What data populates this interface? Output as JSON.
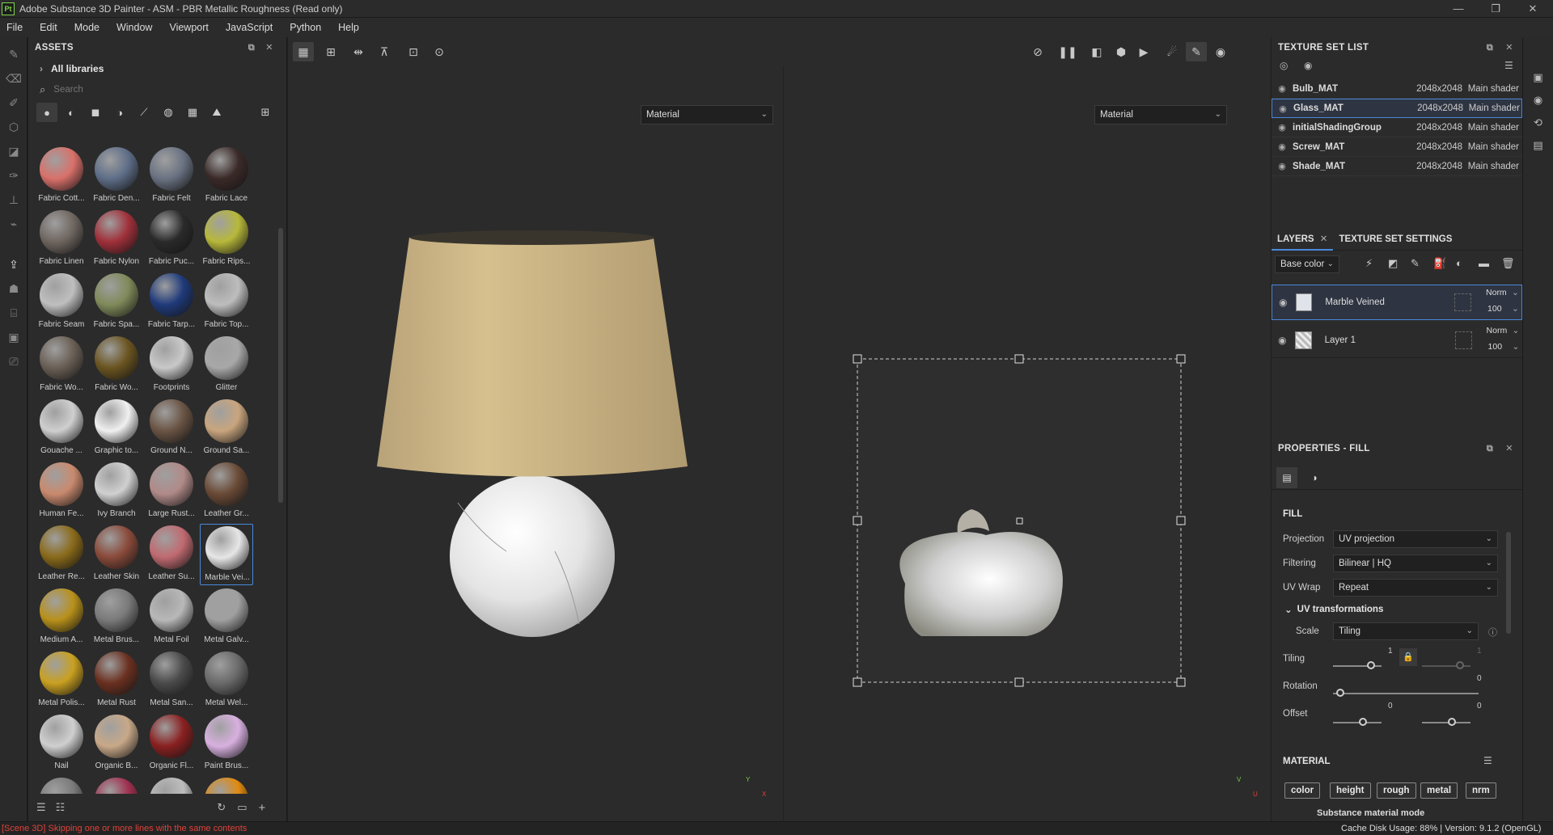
{
  "window": {
    "title": "Adobe Substance 3D Painter - ASM - PBR Metallic Roughness (Read only)",
    "app_badge": "Pt",
    "minimize": "—",
    "maximize": "❐",
    "close": "✕"
  },
  "menu": [
    "File",
    "Edit",
    "Mode",
    "Window",
    "Viewport",
    "JavaScript",
    "Python",
    "Help"
  ],
  "assets": {
    "title": "ASSETS",
    "library": "All libraries",
    "search_placeholder": "Search",
    "items": [
      {
        "label": "Fabric Cott...",
        "color": "#d9706a"
      },
      {
        "label": "Fabric Den...",
        "color": "#5e6e88"
      },
      {
        "label": "Fabric Felt",
        "color": "#6a7282"
      },
      {
        "label": "Fabric Lace",
        "color": "#3a2a28"
      },
      {
        "label": "Fabric Linen",
        "color": "#6f6660"
      },
      {
        "label": "Fabric Nylon",
        "color": "#a0303a"
      },
      {
        "label": "Fabric Puc...",
        "color": "#2a2a2a"
      },
      {
        "label": "Fabric Rips...",
        "color": "#b7b83a"
      },
      {
        "label": "Fabric Seam",
        "color": "#bfbfbf"
      },
      {
        "label": "Fabric Spa...",
        "color": "#7f8a5a"
      },
      {
        "label": "Fabric Tarp...",
        "color": "#1f3a7a"
      },
      {
        "label": "Fabric Top...",
        "color": "#bdbdbd"
      },
      {
        "label": "Fabric Wo...",
        "color": "#6a5f55"
      },
      {
        "label": "Fabric Wo...",
        "color": "#6a5420"
      },
      {
        "label": "Footprints",
        "color": "#c8c8c8"
      },
      {
        "label": "Glitter",
        "color": "#a8a8a8"
      },
      {
        "label": "Gouache ...",
        "color": "#cfcfcf"
      },
      {
        "label": "Graphic to...",
        "color": "#f0f0f0"
      },
      {
        "label": "Ground N...",
        "color": "#6a5444"
      },
      {
        "label": "Ground Sa...",
        "color": "#c9a57e"
      },
      {
        "label": "Human Fe...",
        "color": "#c98a6e"
      },
      {
        "label": "Ivy Branch",
        "color": "#d0d0d0"
      },
      {
        "label": "Large Rust...",
        "color": "#b08a88"
      },
      {
        "label": "Leather Gr...",
        "color": "#6a4a36"
      },
      {
        "label": "Leather Re...",
        "color": "#8a6a1a"
      },
      {
        "label": "Leather Skin",
        "color": "#8a4a3a"
      },
      {
        "label": "Leather Su...",
        "color": "#c06a70"
      },
      {
        "label": "Marble Vei...",
        "color": "#e6e6e6"
      },
      {
        "label": "Medium A...",
        "color": "#b8901a"
      },
      {
        "label": "Metal Brus...",
        "color": "#7a7a7a"
      },
      {
        "label": "Metal Foil",
        "color": "#b8b8b8"
      },
      {
        "label": "Metal Galv...",
        "color": "#a0a0a0"
      },
      {
        "label": "Metal Polis...",
        "color": "#c9a020"
      },
      {
        "label": "Metal Rust",
        "color": "#6a3020"
      },
      {
        "label": "Metal San...",
        "color": "#4a4a4a"
      },
      {
        "label": "Metal Wel...",
        "color": "#6a6a6a"
      },
      {
        "label": "Nail",
        "color": "#cfcfcf"
      },
      {
        "label": "Organic B...",
        "color": "#c8a888"
      },
      {
        "label": "Organic Fl...",
        "color": "#8a2020"
      },
      {
        "label": "Paint Brus...",
        "color": "#d8b0e0"
      },
      {
        "label": "",
        "color": "#7a7a7a"
      },
      {
        "label": "",
        "color": "#a03050"
      },
      {
        "label": "",
        "color": "#bdbdbd"
      },
      {
        "label": "",
        "color": "#e08a10"
      }
    ]
  },
  "viewport": {
    "left_mode": "Material",
    "right_mode": "Material",
    "axis_left": {
      "y": "Y",
      "x": "X"
    },
    "axis_right": {
      "y": "V",
      "x": "U"
    }
  },
  "texture_set_list": {
    "title": "TEXTURE SET LIST",
    "rows": [
      {
        "name": "Bulb_MAT",
        "res": "2048x2048",
        "shader": "Main shader",
        "selected": false
      },
      {
        "name": "Glass_MAT",
        "res": "2048x2048",
        "shader": "Main shader",
        "selected": true
      },
      {
        "name": "initialShadingGroup",
        "res": "2048x2048",
        "shader": "Main shader",
        "selected": false
      },
      {
        "name": "Screw_MAT",
        "res": "2048x2048",
        "shader": "Main shader",
        "selected": false
      },
      {
        "name": "Shade_MAT",
        "res": "2048x2048",
        "shader": "Main shader",
        "selected": false
      }
    ]
  },
  "layers": {
    "tab_layers": "LAYERS",
    "tab_texture_settings": "TEXTURE SET SETTINGS",
    "channel": "Base color",
    "rows": [
      {
        "name": "Marble Veined",
        "blend": "Norm",
        "opacity": "100",
        "selected": true
      },
      {
        "name": "Layer 1",
        "blend": "Norm",
        "opacity": "100",
        "selected": false
      }
    ]
  },
  "properties": {
    "title": "PROPERTIES - FILL",
    "section_fill": "FILL",
    "projection_label": "Projection",
    "projection_value": "UV projection",
    "filtering_label": "Filtering",
    "filtering_value": "Bilinear | HQ",
    "uvwrap_label": "UV Wrap",
    "uvwrap_value": "Repeat",
    "uv_transform_label": "UV transformations",
    "scale_label": "Scale",
    "scale_value": "Tiling",
    "tiling_label": "Tiling",
    "tiling_value_1": "1",
    "tiling_value_2": "1",
    "rotation_label": "Rotation",
    "rotation_value": "0",
    "offset_label": "Offset",
    "offset_value_1": "0",
    "offset_value_2": "0",
    "section_material": "MATERIAL",
    "channels": [
      "color",
      "height",
      "rough",
      "metal",
      "nrm"
    ],
    "material_mode": "Substance material mode"
  },
  "status": {
    "message": "[Scene 3D] Skipping one or more lines with the same contents",
    "cache": "Cache Disk Usage:",
    "cache_value": "88%",
    "version": "Version: 9.1.2 (OpenGL)"
  },
  "colors": {
    "accent": "#4a88d9",
    "error_text": "#e0413a"
  }
}
